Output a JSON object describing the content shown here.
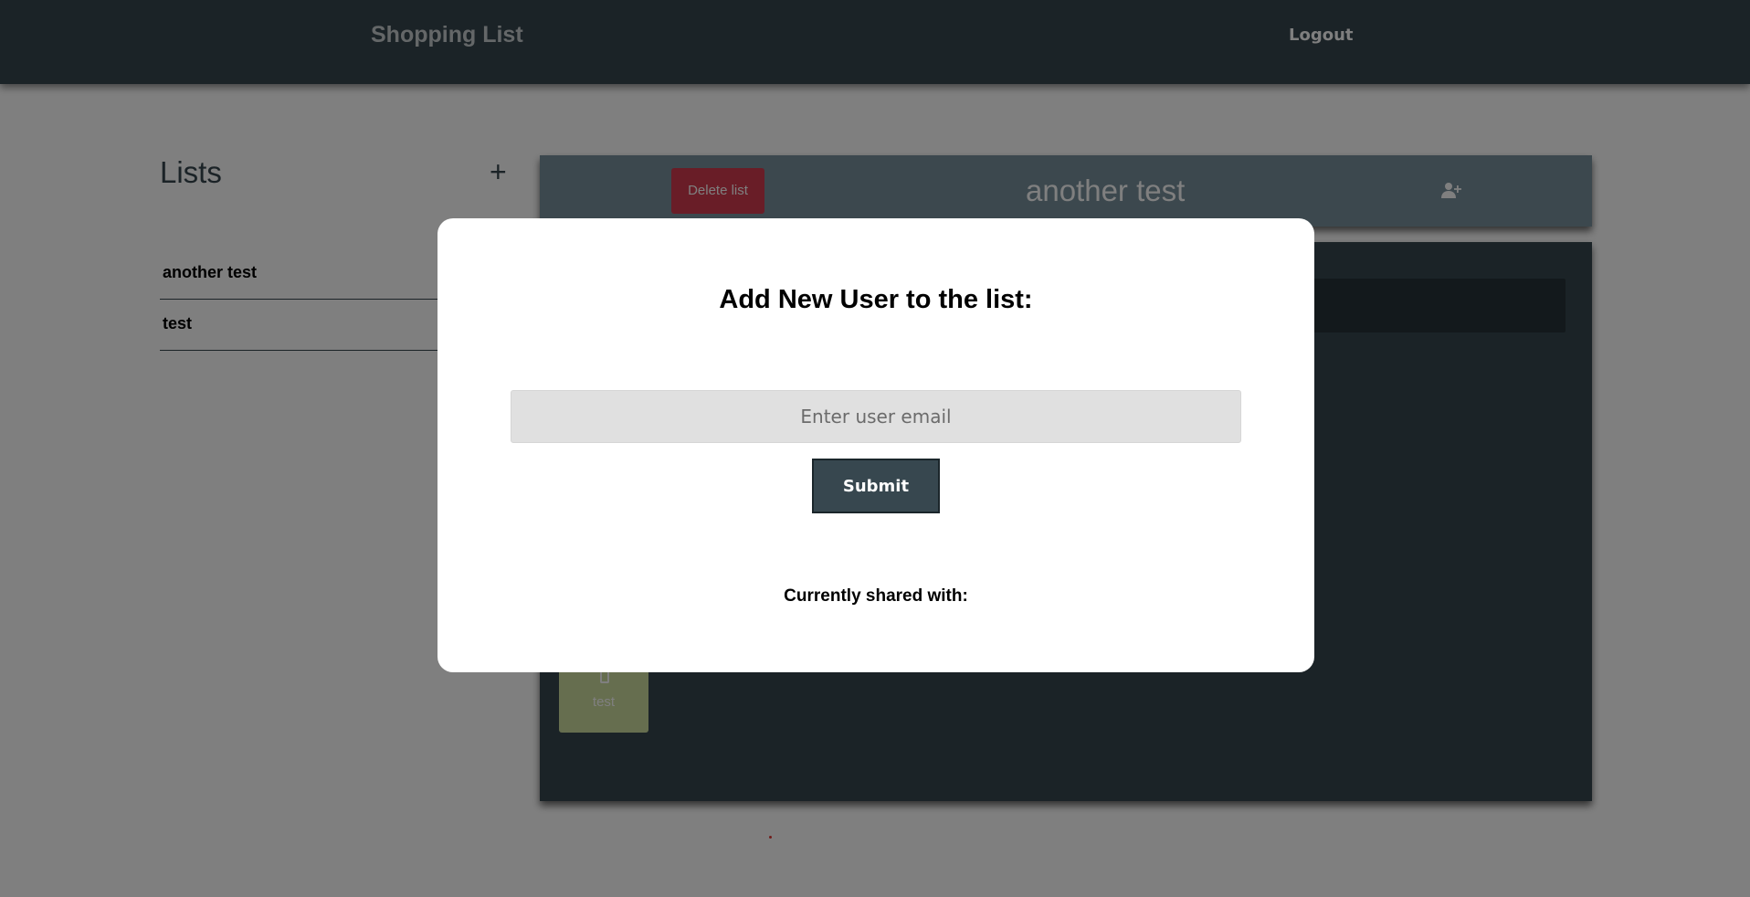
{
  "header": {
    "app_title": "Shopping List",
    "logout_label": "Logout"
  },
  "sidebar": {
    "title": "Lists",
    "add_icon": "plus-icon",
    "items": [
      {
        "label": "another test"
      },
      {
        "label": "test"
      }
    ]
  },
  "list_panel": {
    "delete_label": "Delete list",
    "list_name": "another test",
    "add_user_icon": "user-plus-icon",
    "items": [
      {
        "label": "test",
        "icon": "bottle-icon"
      }
    ]
  },
  "modal": {
    "title": "Add New User to the list:",
    "email_placeholder": "Enter user email",
    "email_value": "",
    "submit_label": "Submit",
    "shared_label": "Currently shared with:"
  },
  "colors": {
    "header_bg": "#37474f",
    "list_header_bg": "#78909c",
    "delete_bg": "#d23b4e",
    "item_card_bg": "#cddc9e",
    "overlay": "rgba(0,0,0,0.5)"
  }
}
